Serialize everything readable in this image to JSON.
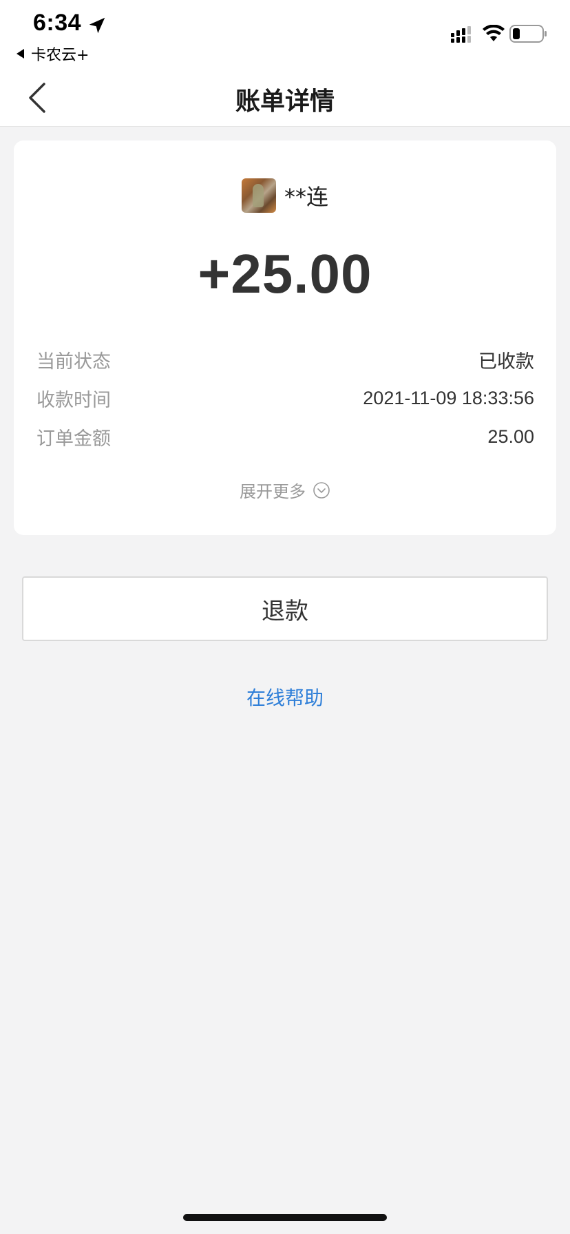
{
  "status_bar": {
    "time": "6:34",
    "back_app_label": "卡农云+",
    "icons": [
      "location-arrow-icon",
      "signal-icon",
      "wifi-icon",
      "battery-icon"
    ]
  },
  "nav": {
    "title": "账单详情",
    "back_icon": "chevron-left-icon"
  },
  "bill": {
    "payer_name": "**连",
    "amount": "+25.00",
    "rows": [
      {
        "label": "当前状态",
        "value": "已收款"
      },
      {
        "label": "收款时间",
        "value": "2021-11-09 18:33:56"
      },
      {
        "label": "订单金额",
        "value": "25.00"
      }
    ],
    "expand_label": "展开更多",
    "expand_icon": "chevron-down-circle-icon"
  },
  "actions": {
    "refund_label": "退款",
    "help_label": "在线帮助"
  },
  "colors": {
    "background": "#f3f3f4",
    "link": "#2f7fd8",
    "label_gray": "#999999",
    "value_dark": "#333333"
  }
}
